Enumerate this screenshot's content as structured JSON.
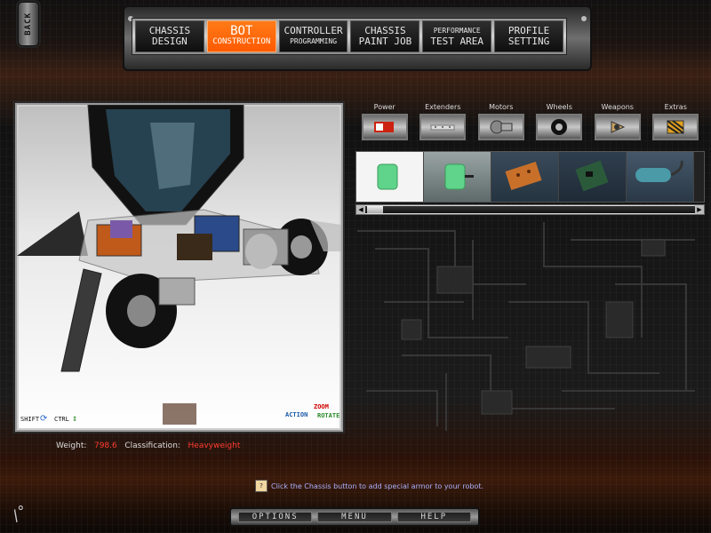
{
  "back": {
    "label": "BACK"
  },
  "nav": {
    "tabs": [
      {
        "line1": "CHASSIS",
        "line2": "DESIGN"
      },
      {
        "line1": "BOT",
        "line2": "CONSTRUCTION"
      },
      {
        "line1": "CONTROLLER",
        "line2": "PROGRAMMING"
      },
      {
        "line1": "CHASSIS",
        "line2": "PAINT JOB"
      },
      {
        "line1": "PERFORMANCE",
        "line2": "TEST AREA"
      },
      {
        "line1": "PROFILE",
        "line2": "SETTING"
      }
    ],
    "active_index": 1
  },
  "viewport_controls": {
    "shift": "SHIFT",
    "ctrl": "CTRL",
    "action": "ACTION",
    "zoom": "ZOOM",
    "rotate": "ROTATE"
  },
  "categories": [
    {
      "label": "Power",
      "icon": "battery-icon"
    },
    {
      "label": "Extenders",
      "icon": "extender-icon"
    },
    {
      "label": "Motors",
      "icon": "motor-icon"
    },
    {
      "label": "Wheels",
      "icon": "wheel-icon"
    },
    {
      "label": "Weapons",
      "icon": "weapon-icon"
    },
    {
      "label": "Extras",
      "icon": "extras-icon"
    }
  ],
  "stats": {
    "weight_label": "Weight:",
    "weight_value": "798.6",
    "class_label": "Classification:",
    "class_value": "Heavyweight"
  },
  "hint": {
    "text": "Click the Chassis button to add special armor to your robot."
  },
  "bottom": {
    "options": "OPTIONS",
    "menu": "MENU",
    "help": "HELP"
  },
  "colors": {
    "accent": "#ff6a00",
    "stat_value": "#ff3b2e",
    "hint": "#aab0ff"
  }
}
